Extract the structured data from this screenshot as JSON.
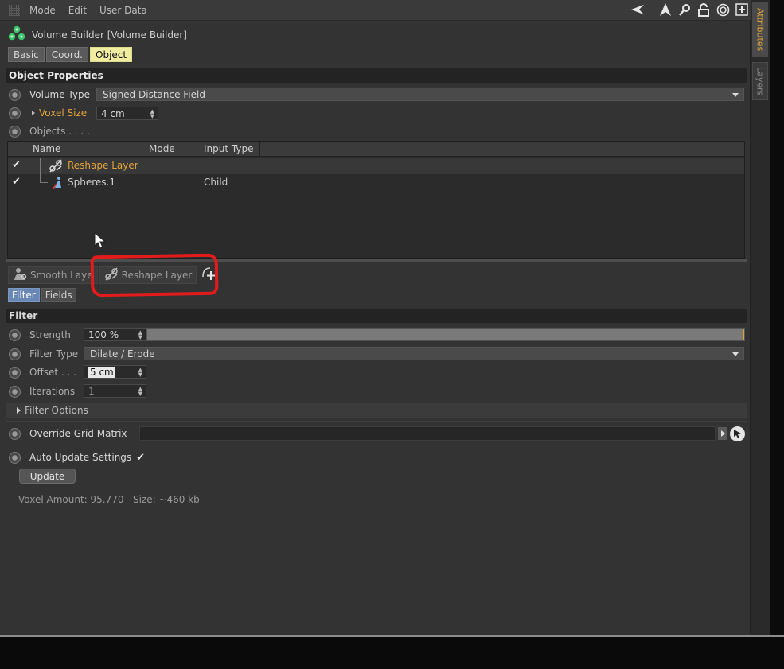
{
  "menubar": {
    "items": [
      "Mode",
      "Edit",
      "User Data"
    ],
    "tools": [
      "back-arrow-icon",
      "up-arrow-icon",
      "search-icon",
      "lock-icon",
      "target-icon",
      "new-panel-icon"
    ]
  },
  "object": {
    "title": "Volume Builder [Volume Builder]",
    "icon": "volume-builder-icon"
  },
  "tabs": [
    "Basic",
    "Coord.",
    "Object"
  ],
  "active_tab": "Object",
  "object_properties": {
    "header": "Object Properties",
    "volume_type_label": "Volume Type",
    "volume_type_value": "Signed Distance Field",
    "voxel_size_label": "Voxel Size",
    "voxel_size_value": "4 cm",
    "objects_label": "Objects . . . ."
  },
  "object_list": {
    "columns": [
      "Name",
      "Mode",
      "Input Type"
    ],
    "rows": [
      {
        "name": "Reshape Layer",
        "mode": "",
        "input_type": "",
        "checked": true
      },
      {
        "name": "Spheres.1",
        "mode": "",
        "input_type": "Child",
        "checked": true
      }
    ]
  },
  "layer_tabs": [
    "Smooth Laye",
    "Reshape Layer"
  ],
  "sub_tabs": [
    "Filter",
    "Fields"
  ],
  "active_sub_tab": "Filter",
  "filter": {
    "header": "Filter",
    "strength_label": "Strength",
    "strength_value": "100 %",
    "strength_fraction": 1.0,
    "filter_type_label": "Filter Type",
    "filter_type_value": "Dilate / Erode",
    "offset_label": "Offset . . .",
    "offset_value": "5 cm",
    "iterations_label": "Iterations",
    "iterations_value": "1",
    "options_label": "Filter Options"
  },
  "override": {
    "label": "Override Grid Matrix"
  },
  "auto_update": {
    "label": "Auto Update Settings",
    "checked": true,
    "button": "Update"
  },
  "status": {
    "voxel_amount": "Voxel Amount: 95.770",
    "size": "Size: ~460 kb"
  },
  "side_tabs": [
    "Attributes",
    "Layers"
  ],
  "colors": {
    "active_tab": "#f0eca0",
    "orange_label": "#e2a33a",
    "sub_tab_active": "#6a88b6",
    "annotation_red": "#e21c1c"
  }
}
